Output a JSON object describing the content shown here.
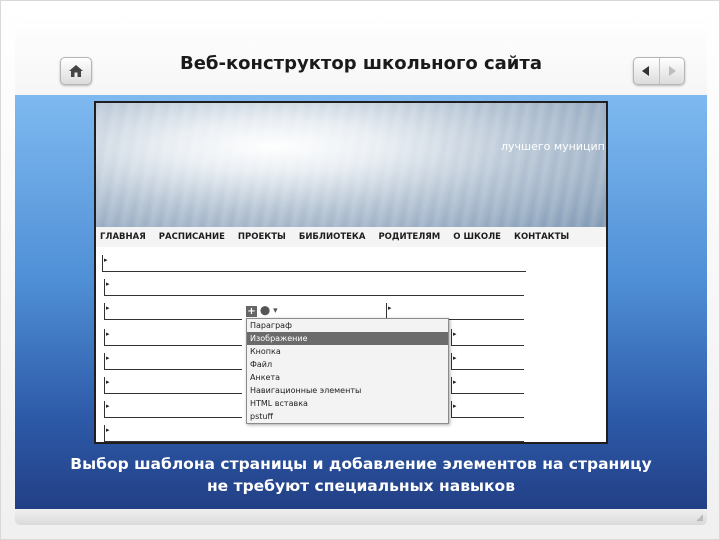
{
  "header": {
    "title": "Веб-конструктор школьного сайта"
  },
  "icons": {
    "home": "home-icon",
    "prev": "arrow-left-icon",
    "next": "arrow-right-icon"
  },
  "screenshot": {
    "banner_text": "лучшего муницип",
    "menu": [
      "ГЛАВНАЯ",
      "РАСПИСАНИЕ",
      "ПРОЕКТЫ",
      "БИБЛИОТЕКА",
      "РОДИТЕЛЯМ",
      "О ШКОЛЕ",
      "КОНТАКТЫ"
    ],
    "dropdown_items": [
      "Параграф",
      "Изображение",
      "Кнопка",
      "Файл",
      "Анкета",
      "Навигационные элементы",
      "HTML вставка",
      "pstuff"
    ],
    "selected_item": "Изображение"
  },
  "caption": {
    "line1": "Выбор шаблона страницы и добавление элементов на страницу",
    "line2": "не требуют специальных навыков"
  },
  "colors": {
    "accent_blue": "#4f8fd6",
    "dark_blue": "#223f86"
  }
}
